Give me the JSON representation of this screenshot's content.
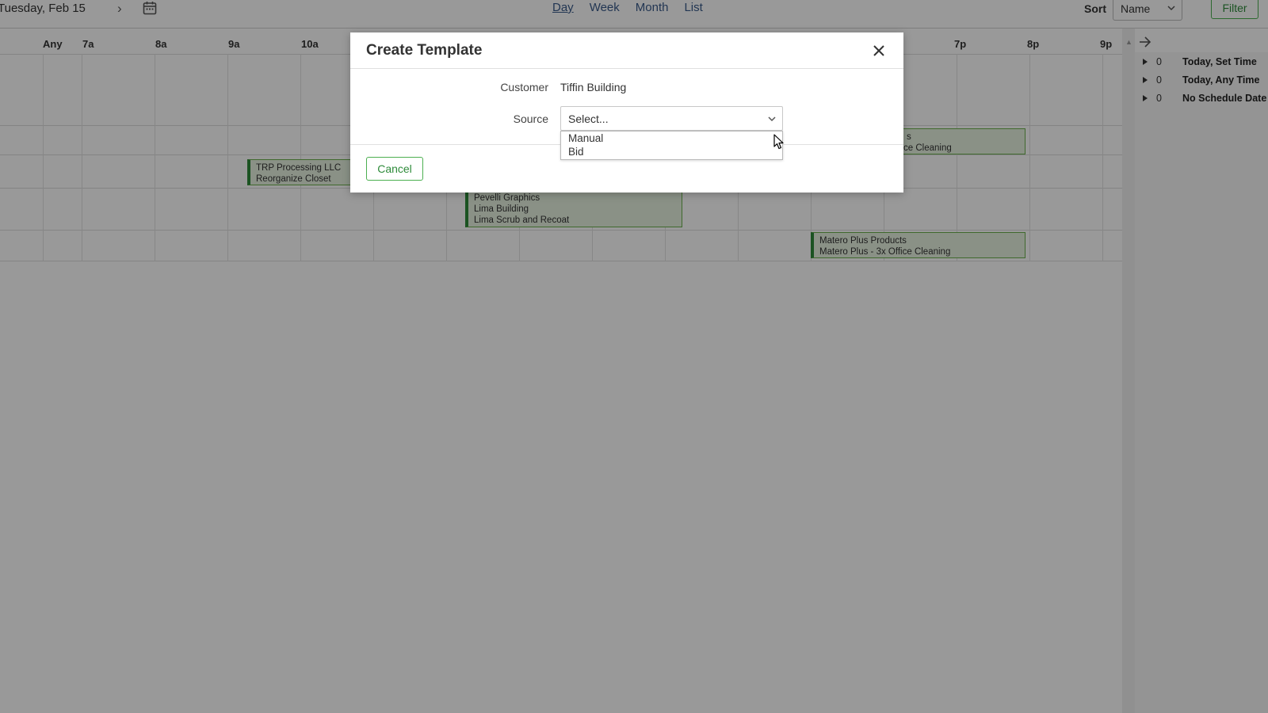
{
  "header": {
    "date_label": "Tuesday, Feb 15",
    "next_icon": "chevron-right-icon",
    "calendar_icon": "calendar-icon",
    "views": [
      "Day",
      "Week",
      "Month",
      "List"
    ],
    "active_view": "Day",
    "sort_label": "Sort",
    "sort_value": "Name",
    "filter_label": "Filter"
  },
  "schedule": {
    "hours": [
      "Any",
      "7a",
      "8a",
      "9a",
      "10a",
      "7p",
      "8p",
      "9p"
    ],
    "events": [
      {
        "lines": [
          "TRP Processing LLC",
          "Reorganize Closet"
        ]
      },
      {
        "lines": [
          "Pevelli Graphics",
          "Lima Building",
          "Lima Scrub and Recoat"
        ]
      },
      {
        "lines": [
          "Matero Plus Products",
          "Matero Plus - 3x Office Cleaning"
        ]
      },
      {
        "lines": [
          "s",
          "ce Cleaning"
        ]
      }
    ]
  },
  "unscheduled_panel": {
    "items": [
      {
        "count": "0",
        "label": "Today, Set Time"
      },
      {
        "count": "0",
        "label": "Today, Any Time"
      },
      {
        "count": "0",
        "label": "No Schedule Date"
      }
    ]
  },
  "modal": {
    "title": "Create Template",
    "customer_label": "Customer",
    "customer_value": "Tiffin Building",
    "source_label": "Source",
    "source_placeholder": "Select...",
    "source_options": [
      "Manual",
      "Bid"
    ],
    "cancel_label": "Cancel",
    "close_icon": "close-icon"
  },
  "colors": {
    "accent_green": "#2e8b3a",
    "event_fill": "#e6f2e0",
    "link_blue": "#3a5a8a",
    "overlay": "rgba(0,0,0,0.40)"
  }
}
